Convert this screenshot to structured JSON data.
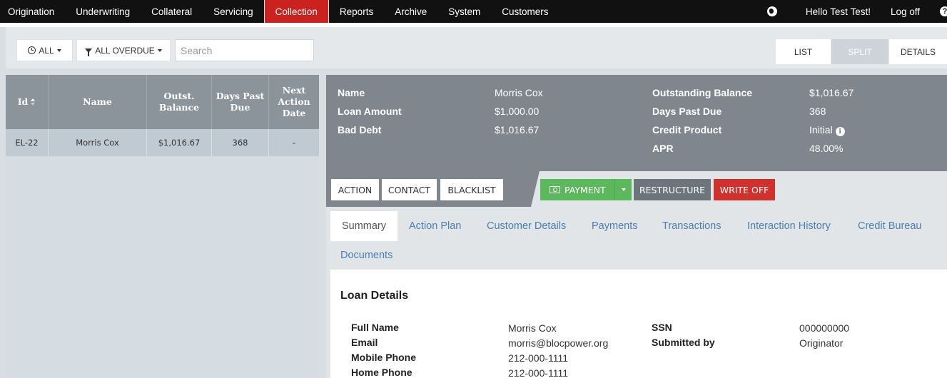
{
  "nav": {
    "items": [
      "Origination",
      "Underwriting",
      "Collateral",
      "Servicing",
      "Collection",
      "Reports",
      "Archive",
      "System",
      "Customers"
    ],
    "active": "Collection",
    "greeting": "Hello Test Test!",
    "logoff": "Log off",
    "icons": [
      "globe-icon",
      "help-icon"
    ]
  },
  "toolbar": {
    "all_label": "ALL",
    "overdue_label": "ALL OVERDUE",
    "search_placeholder": "Search",
    "views": [
      "LIST",
      "SPLIT",
      "DETAILS"
    ],
    "active_view": "SPLIT"
  },
  "list": {
    "headers": [
      "Id",
      "Name",
      "Outst. Balance",
      "Days Past Due",
      "Next Action Date"
    ],
    "rows": [
      {
        "id": "EL-22",
        "name": "Morris Cox",
        "balance": "$1,016.67",
        "days": "368",
        "next": "-"
      }
    ]
  },
  "summary": {
    "name_label": "Name",
    "name_value": "Morris Cox",
    "loan_amount_label": "Loan Amount",
    "loan_amount_value": "$1,000.00",
    "bad_debt_label": "Bad Debt",
    "bad_debt_value": "$1,016.67",
    "outstanding_label": "Outstanding Balance",
    "outstanding_value": "$1,016.67",
    "days_label": "Days Past Due",
    "days_value": "368",
    "credit_product_label": "Credit Product",
    "credit_product_value": "Initial",
    "apr_label": "APR",
    "apr_value": "48.00%"
  },
  "actions": {
    "action": "ACTION",
    "contact": "CONTACT",
    "blacklist": "BLACKLIST",
    "payment": "PAYMENT",
    "restructure": "RESTRUCTURE",
    "writeoff": "WRITE OFF"
  },
  "tabs": [
    "Summary",
    "Action Plan",
    "Customer Details",
    "Payments",
    "Transactions",
    "Interaction History",
    "Credit Bureau",
    "Documents"
  ],
  "active_tab": "Summary",
  "loan_details": {
    "title": "Loan Details",
    "full_name_label": "Full Name",
    "full_name_value": "Morris Cox",
    "email_label": "Email",
    "email_value": "morris@blocpower.org",
    "mobile_label": "Mobile Phone",
    "mobile_value": "212-000-1111",
    "home_label": "Home Phone",
    "home_value": "212-000-1111",
    "ssn_label": "SSN",
    "ssn_value": "000000000",
    "submitted_label": "Submitted by",
    "submitted_value": "Originator"
  },
  "colors": {
    "nav_bg": "#111111",
    "active_nav": "#c9221f",
    "payment": "#5cb85c",
    "writeoff": "#d0312d",
    "restructure": "#6c757c",
    "header_bg": "#7f868d",
    "link": "#4a7fb0"
  }
}
